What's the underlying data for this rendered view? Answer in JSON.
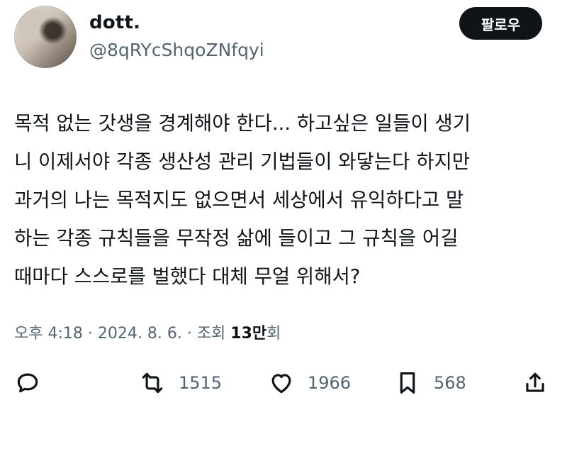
{
  "author": {
    "name": "dott.",
    "handle": "@8qRYcShqoZNfqyi"
  },
  "follow_button": "팔로우",
  "tweet_lines": [
    "목적 없는 갓생을 경계해야 한다... 하고싶은 일들이 생기",
    "니 이제서야 각종 생산성 관리 기법들이 와닿는다 하지만",
    "과거의 나는 목적지도 없으면서 세상에서 유익하다고 말",
    "하는 각종 규칙들을 무작정 삶에 들이고 그 규칙을 어길",
    "때마다 스스로를 벌했다 대체 무얼 위해서?"
  ],
  "meta": {
    "time": "오후 4:18",
    "sep1": " · ",
    "date": "2024. 8. 6.",
    "sep2": " · ",
    "views_label": "조회 ",
    "views_count": "13만",
    "views_suffix": "회"
  },
  "actions": {
    "reply_icon": "reply-icon",
    "retweet_count": "1515",
    "like_count": "1966",
    "bookmark_count": "568",
    "share_icon": "share-icon"
  },
  "colors": {
    "text": "#0f1419",
    "secondary": "#536471",
    "button_bg": "#0f1419",
    "button_text": "#ffffff"
  }
}
